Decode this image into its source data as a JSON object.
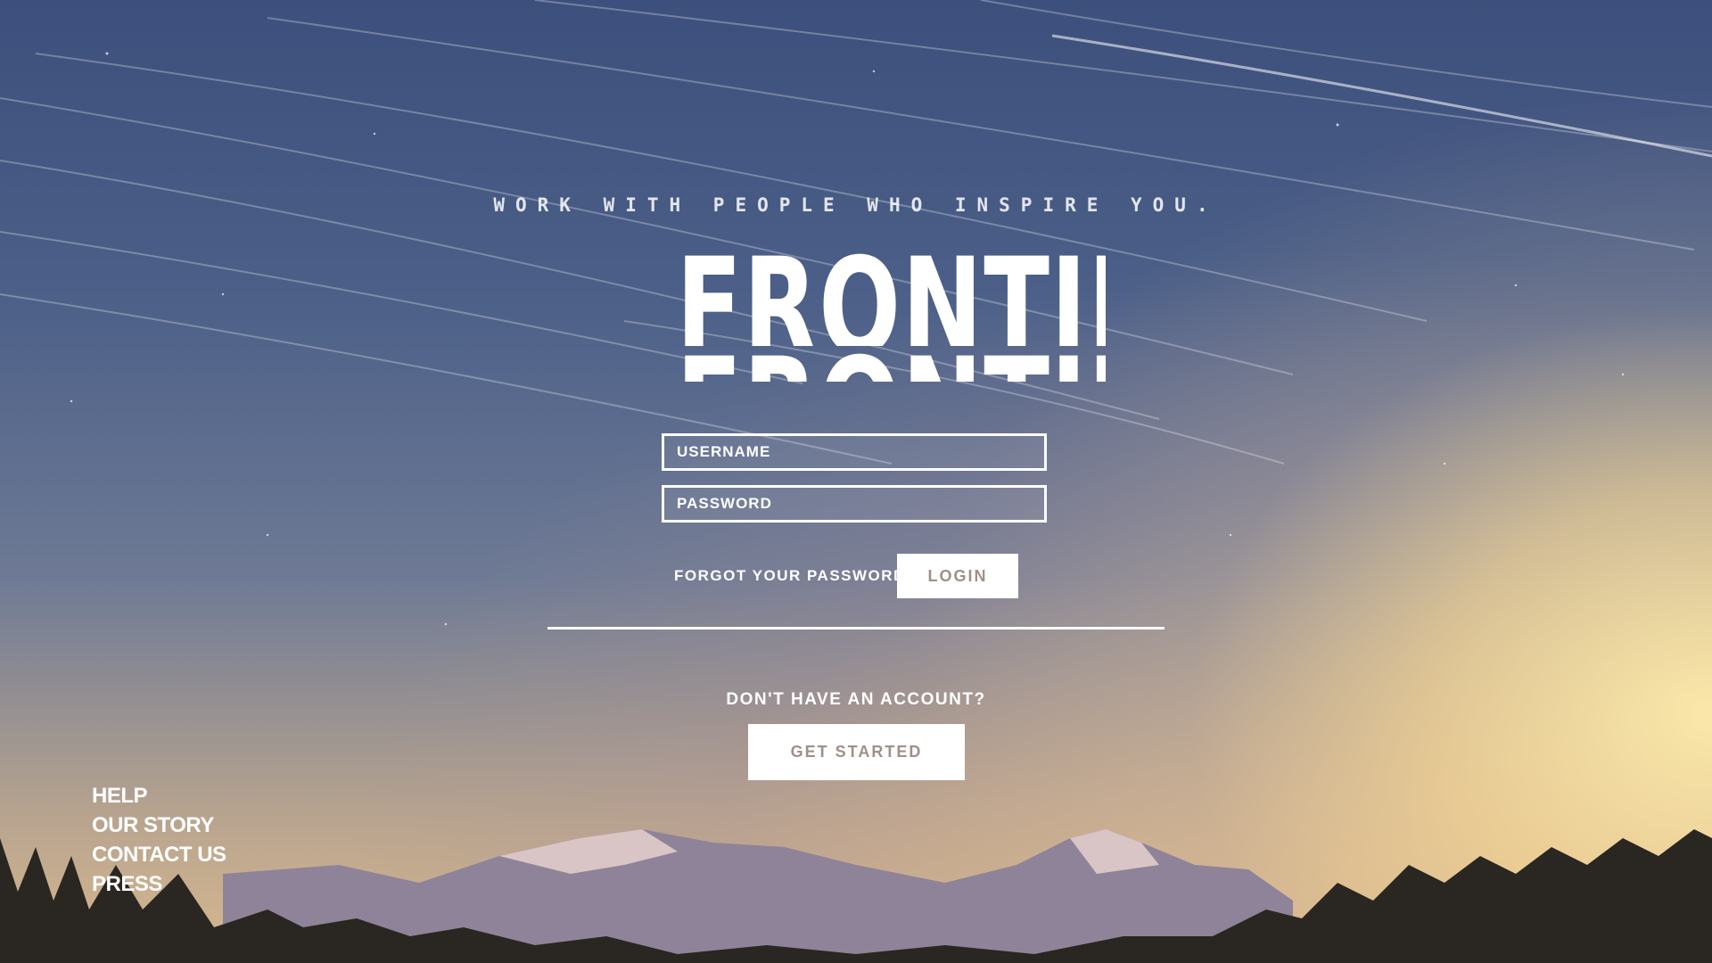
{
  "tagline": "WORK WITH PEOPLE WHO INSPIRE YOU.",
  "logo": "FRONTIER",
  "login_form": {
    "username_placeholder": "USERNAME",
    "password_placeholder": "PASSWORD",
    "forgot_link": "FORGOT YOUR PASSWORD?",
    "login_button": "LOGIN"
  },
  "signup": {
    "prompt": "DON'T HAVE AN ACCOUNT?",
    "button": "GET STARTED"
  },
  "footer": {
    "links": [
      "HELP",
      "OUR STORY",
      "CONTACT US",
      "PRESS"
    ]
  },
  "colors": {
    "button_text": "#a08f8a",
    "accent": "#ffffff"
  }
}
